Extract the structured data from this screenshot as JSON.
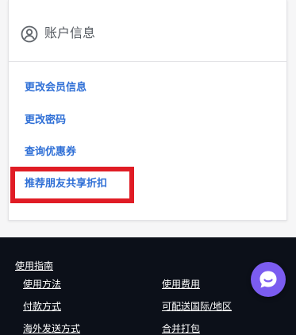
{
  "account": {
    "header_title": "账户信息",
    "links": [
      "更改会员信息",
      "更改密码",
      "查询优惠券",
      "推荐朋友共享折扣"
    ]
  },
  "footer": {
    "section_title": "使用指南",
    "links_left": [
      "使用方法",
      "付款方式",
      "海外发送方式"
    ],
    "links_right": [
      "使用费用",
      "可配送国际/地区",
      "合并打包"
    ]
  },
  "colors": {
    "link": "#2f6fd6",
    "highlight_border": "#e01c25",
    "footer_bg": "#0c1019",
    "chat_button": "#7b5cf0"
  },
  "icons": {
    "header": "user-circle-icon",
    "chat": "chat-bubble-icon"
  }
}
